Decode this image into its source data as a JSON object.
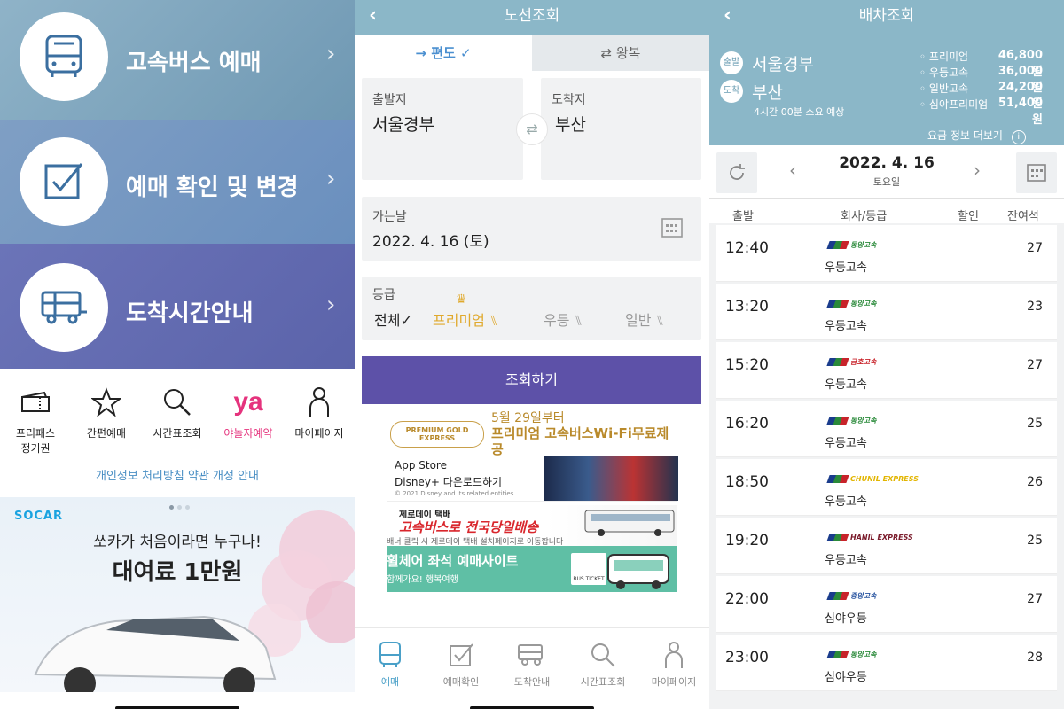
{
  "panel1": {
    "menu": [
      {
        "label": "고속버스 예매",
        "icon": "bus-front-icon"
      },
      {
        "label": "예매 확인 및 변경",
        "icon": "checkbox-icon"
      },
      {
        "label": "도착시간안내",
        "icon": "bus-side-icon"
      }
    ],
    "quick": [
      {
        "label_l1": "프리패스",
        "label_l2": "정기권",
        "icon": "ticket-icon"
      },
      {
        "label_l1": "간편예매",
        "label_l2": "",
        "icon": "star-icon"
      },
      {
        "label_l1": "시간표조회",
        "label_l2": "",
        "icon": "search-icon"
      },
      {
        "label_l1": "야놀자예약",
        "label_l2": "",
        "icon": "yanolja-logo",
        "logo_text": "ya"
      },
      {
        "label_l1": "마이페이지",
        "label_l2": "",
        "icon": "person-icon"
      }
    ],
    "privacy_notice": "개인정보 처리방침 약관 개정 안내",
    "banner": {
      "brand": "SOCAR",
      "line1": "쏘카가 처음이라면 누구나!",
      "line2": "대여료 1만원"
    }
  },
  "panel2": {
    "title": "노선조회",
    "trip_tabs": {
      "oneway": "→ 편도 ✓",
      "round": "⇄ 왕복"
    },
    "departure": {
      "label": "출발지",
      "value": "서울경부"
    },
    "arrival": {
      "label": "도착지",
      "value": "부산"
    },
    "date": {
      "label": "가는날",
      "value": "2022. 4. 16 (토)"
    },
    "grade": {
      "label": "등급",
      "all": "전체✓",
      "premium": "프리미엄",
      "superior": "우등",
      "standard": "일반"
    },
    "search_button": "조회하기",
    "promo": {
      "gold_l1": "5월 29일부터",
      "gold_l2": "프리미엄 고속버스Wi-Fi무료제공",
      "badge": "PREMIUM GOLD EXPRESS",
      "ad1_store": " App Store",
      "ad1_title": "Disney+ 다운로드하기",
      "ad1_copy": "© 2021 Disney and its related entities",
      "ad2_small": "제로데이 택배",
      "ad2_big": "고속버스로 전국당일배송",
      "ad2_sub": "배너 클릭 시 제로데이 택배 설치페이지로 이동합니다",
      "ad3_title": "휠체어 좌석 예매사이트",
      "ad3_sub": "함께가요! 행복여행",
      "ad3_tag": "BUS TICKET"
    },
    "tabs": [
      {
        "label": "예매",
        "icon": "bus-front-icon"
      },
      {
        "label": "예매확인",
        "icon": "checkbox-icon"
      },
      {
        "label": "도착안내",
        "icon": "bus-side-icon"
      },
      {
        "label": "시간표조회",
        "icon": "search-icon"
      },
      {
        "label": "마이페이지",
        "icon": "person-icon"
      }
    ]
  },
  "panel3": {
    "title": "배차조회",
    "route": {
      "dep_badge": "출발",
      "arr_badge": "도착",
      "from": "서울경부",
      "to": "부산",
      "duration": "4시간 00분 소요 예상"
    },
    "fares": [
      {
        "grade": "프리미엄",
        "price": "46,800원"
      },
      {
        "grade": "우등고속",
        "price": "36,000원"
      },
      {
        "grade": "일반고속",
        "price": "24,200원"
      },
      {
        "grade": "심야프리미엄",
        "price": "51,400원"
      }
    ],
    "more_fares": "요금 정보 더보기",
    "date": "2022. 4. 16",
    "weekday": "토요일",
    "columns": {
      "dep": "출발",
      "company": "회사/등급",
      "discount": "할인",
      "seats": "잔여석"
    },
    "schedules": [
      {
        "time": "12:40",
        "company": "동양고속",
        "grade": "우등고속",
        "seats": "27"
      },
      {
        "time": "13:20",
        "company": "동양고속",
        "grade": "우등고속",
        "seats": "23"
      },
      {
        "time": "15:20",
        "company": "금호고속",
        "grade": "우등고속",
        "seats": "27"
      },
      {
        "time": "16:20",
        "company": "동양고속",
        "grade": "우등고속",
        "seats": "25"
      },
      {
        "time": "18:50",
        "company": "CHUNIL EXPRESS",
        "grade": "우등고속",
        "seats": "26"
      },
      {
        "time": "19:20",
        "company": "HANIL EXPRESS",
        "grade": "우등고속",
        "seats": "25"
      },
      {
        "time": "22:00",
        "company": "중앙고속",
        "grade": "심야우등",
        "seats": "27"
      },
      {
        "time": "23:00",
        "company": "동양고속",
        "grade": "심야우등",
        "seats": "28"
      }
    ]
  }
}
